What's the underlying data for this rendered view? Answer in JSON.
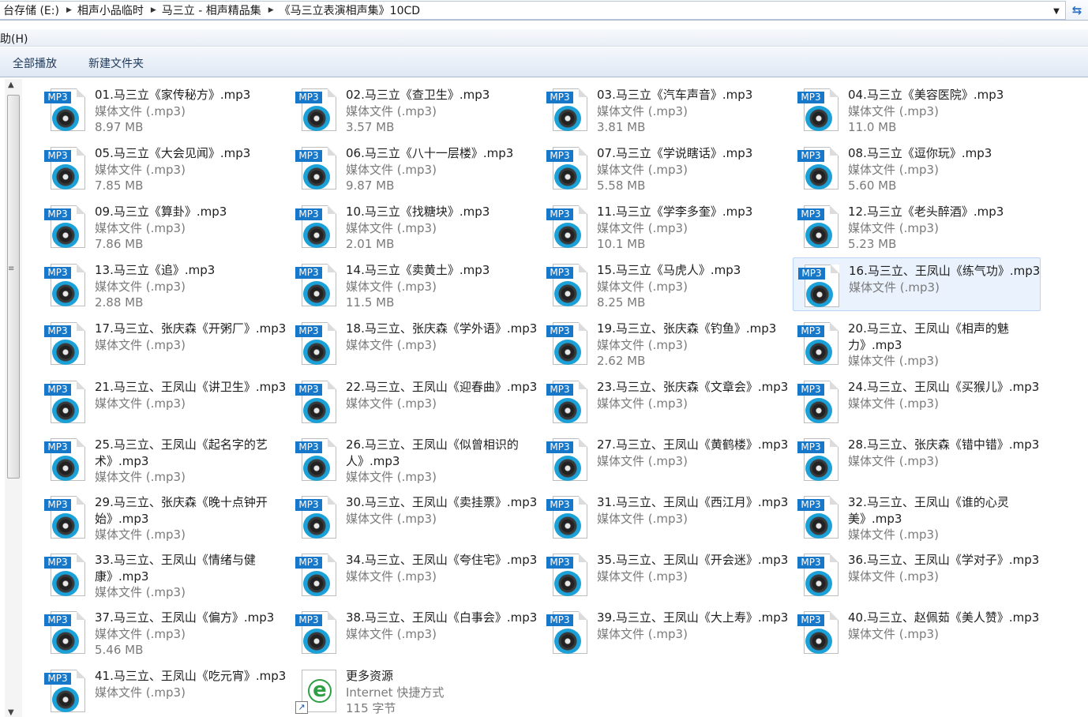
{
  "address": {
    "crumbs": [
      "台存储 (E:)",
      "相声小品临时",
      "马三立 - 相声精品集",
      "《马三立表演相声集》10CD"
    ],
    "dropdown_icon": "chevron-down-icon",
    "refresh_icon": "refresh-icon"
  },
  "menubar": {
    "help_label": "助(H)"
  },
  "toolbar": {
    "play_all": "全部播放",
    "new_folder": "新建文件夹"
  },
  "files": [
    {
      "name": "01.马三立《家传秘方》.mp3",
      "type": "媒体文件 (.mp3)",
      "size": "8.97 MB"
    },
    {
      "name": "02.马三立《查卫生》.mp3",
      "type": "媒体文件 (.mp3)",
      "size": "3.57 MB"
    },
    {
      "name": "03.马三立《汽车声音》.mp3",
      "type": "媒体文件 (.mp3)",
      "size": "3.81 MB"
    },
    {
      "name": "04.马三立《美容医院》.mp3",
      "type": "媒体文件 (.mp3)",
      "size": "11.0 MB"
    },
    {
      "name": "05.马三立《大会见闻》.mp3",
      "type": "媒体文件 (.mp3)",
      "size": "7.85 MB"
    },
    {
      "name": "06.马三立《八十一层楼》.mp3",
      "type": "媒体文件 (.mp3)",
      "size": "9.87 MB"
    },
    {
      "name": "07.马三立《学说瞎话》.mp3",
      "type": "媒体文件 (.mp3)",
      "size": "5.58 MB"
    },
    {
      "name": "08.马三立《逗你玩》.mp3",
      "type": "媒体文件 (.mp3)",
      "size": "5.60 MB"
    },
    {
      "name": "09.马三立《算卦》.mp3",
      "type": "媒体文件 (.mp3)",
      "size": "7.86 MB"
    },
    {
      "name": "10.马三立《找糖块》.mp3",
      "type": "媒体文件 (.mp3)",
      "size": "2.01 MB"
    },
    {
      "name": "11.马三立《学李多奎》.mp3",
      "type": "媒体文件 (.mp3)",
      "size": "10.1 MB"
    },
    {
      "name": "12.马三立《老头醉酒》.mp3",
      "type": "媒体文件 (.mp3)",
      "size": "5.23 MB"
    },
    {
      "name": "13.马三立《追》.mp3",
      "type": "媒体文件 (.mp3)",
      "size": "2.88 MB"
    },
    {
      "name": "14.马三立《卖黄土》.mp3",
      "type": "媒体文件 (.mp3)",
      "size": "11.5 MB"
    },
    {
      "name": "15.马三立《马虎人》.mp3",
      "type": "媒体文件 (.mp3)",
      "size": "8.25 MB"
    },
    {
      "name": "16.马三立、王凤山《练气功》.mp3",
      "type": "媒体文件 (.mp3)",
      "size": ""
    },
    {
      "name": "17.马三立、张庆森《开粥厂》.mp3",
      "type": "媒体文件 (.mp3)",
      "size": ""
    },
    {
      "name": "18.马三立、张庆森《学外语》.mp3",
      "type": "媒体文件 (.mp3)",
      "size": ""
    },
    {
      "name": "19.马三立、张庆森《钓鱼》.mp3",
      "type": "媒体文件 (.mp3)",
      "size": "2.62 MB"
    },
    {
      "name": "20.马三立、王凤山《相声的魅力》.mp3",
      "type": "媒体文件 (.mp3)",
      "size": ""
    },
    {
      "name": "21.马三立、王凤山《讲卫生》.mp3",
      "type": "媒体文件 (.mp3)",
      "size": ""
    },
    {
      "name": "22.马三立、王凤山《迎春曲》.mp3",
      "type": "媒体文件 (.mp3)",
      "size": ""
    },
    {
      "name": "23.马三立、张庆森《文章会》.mp3",
      "type": "媒体文件 (.mp3)",
      "size": ""
    },
    {
      "name": "24.马三立、王凤山《买猴儿》.mp3",
      "type": "媒体文件 (.mp3)",
      "size": ""
    },
    {
      "name": "25.马三立、王凤山《起名字的艺术》.mp3",
      "type": "媒体文件 (.mp3)",
      "size": ""
    },
    {
      "name": "26.马三立、王凤山《似曾相识的人》.mp3",
      "type": "媒体文件 (.mp3)",
      "size": ""
    },
    {
      "name": "27.马三立、王凤山《黄鹤楼》.mp3",
      "type": "媒体文件 (.mp3)",
      "size": ""
    },
    {
      "name": "28.马三立、张庆森《错中错》.mp3",
      "type": "媒体文件 (.mp3)",
      "size": ""
    },
    {
      "name": "29.马三立、张庆森《晚十点钟开始》.mp3",
      "type": "媒体文件 (.mp3)",
      "size": ""
    },
    {
      "name": "30.马三立、王凤山《卖挂票》.mp3",
      "type": "媒体文件 (.mp3)",
      "size": ""
    },
    {
      "name": "31.马三立、王凤山《西江月》.mp3",
      "type": "媒体文件 (.mp3)",
      "size": ""
    },
    {
      "name": "32.马三立、王凤山《谁的心灵美》.mp3",
      "type": "媒体文件 (.mp3)",
      "size": ""
    },
    {
      "name": "33.马三立、王凤山《情绪与健康》.mp3",
      "type": "媒体文件 (.mp3)",
      "size": ""
    },
    {
      "name": "34.马三立、王凤山《夸住宅》.mp3",
      "type": "媒体文件 (.mp3)",
      "size": ""
    },
    {
      "name": "35.马三立、王凤山《开会迷》.mp3",
      "type": "媒体文件 (.mp3)",
      "size": ""
    },
    {
      "name": "36.马三立、王凤山《学对子》.mp3",
      "type": "媒体文件 (.mp3)",
      "size": ""
    },
    {
      "name": "37.马三立、王凤山《偏方》.mp3",
      "type": "媒体文件 (.mp3)",
      "size": "5.46 MB"
    },
    {
      "name": "38.马三立、王凤山《白事会》.mp3",
      "type": "媒体文件 (.mp3)",
      "size": ""
    },
    {
      "name": "39.马三立、王凤山《大上寿》.mp3",
      "type": "媒体文件 (.mp3)",
      "size": ""
    },
    {
      "name": "40.马三立、赵佩茹《美人赞》.mp3",
      "type": "媒体文件 (.mp3)",
      "size": ""
    },
    {
      "name": "41.马三立、王凤山《吃元宵》.mp3",
      "type": "媒体文件 (.mp3)",
      "size": ""
    },
    {
      "name": "更多资源",
      "type": "Internet 快捷方式",
      "size": "115 字节",
      "icon": "internet-shortcut-icon"
    }
  ],
  "selected_index": 15,
  "colors": {
    "selection": "#eaf3fd",
    "selection_border": "#b9d4f1",
    "mp3_tag": "#1778c9",
    "secondary_text": "#7a7a7a"
  }
}
